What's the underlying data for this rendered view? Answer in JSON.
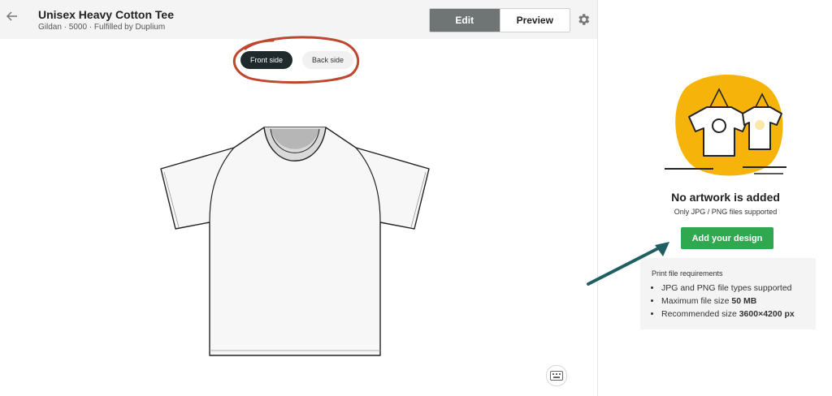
{
  "header": {
    "back_icon": "arrow-left-icon",
    "title": "Unisex Heavy Cotton Tee",
    "subtitle": "Gildan · 5000 · Fulfilled by Duplium",
    "edit_label": "Edit",
    "preview_label": "Preview",
    "settings_icon": "gear-icon"
  },
  "sides": {
    "front_label": "Front side",
    "back_label": "Back side",
    "selected": "Front side"
  },
  "canvas": {
    "keyboard_icon": "keyboard-icon"
  },
  "empty_state": {
    "title": "No artwork is added",
    "subtitle": "Only JPG / PNG files supported",
    "add_button": "Add your design"
  },
  "requirements": {
    "title": "Print file requirements",
    "items": [
      {
        "text": "JPG and PNG file types supported",
        "bold": ""
      },
      {
        "text": "Maximum file size ",
        "bold": "50 MB"
      },
      {
        "text": "Recommended size ",
        "bold": "3600×4200 px"
      }
    ]
  },
  "colors": {
    "accent_green": "#2fa84f",
    "active_toggle": "#6f7575",
    "front_side_active": "#1e2a2c",
    "annotation_red": "#c0472f",
    "annotation_arrow": "#1f5f63",
    "illustration_yellow": "#f6b40b"
  }
}
